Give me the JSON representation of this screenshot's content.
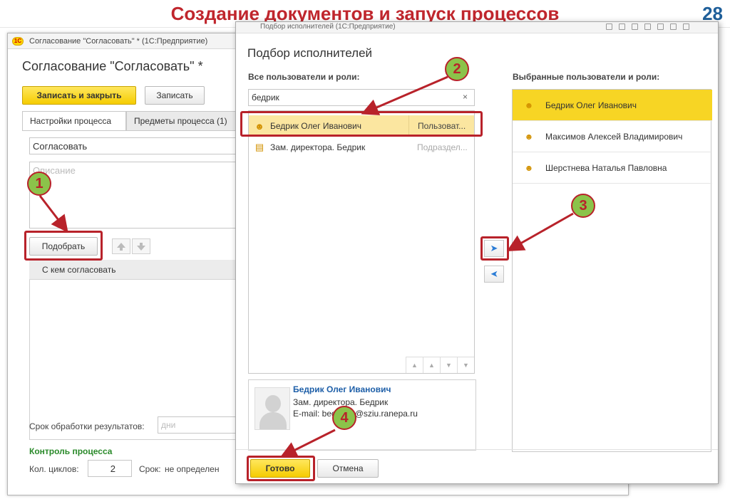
{
  "slide": {
    "title": "Создание документов и запуск процессов",
    "page_number": "28"
  },
  "main_window": {
    "caption": "Согласование \"Согласовать\" * (1С:Предприятие)",
    "logo_text": "1С",
    "form_title": "Согласование \"Согласовать\" *",
    "buttons": {
      "save_close": "Записать и закрыть",
      "save": "Записать",
      "pick": "Подобрать"
    },
    "tabs": [
      {
        "label": "Настройки процесса"
      },
      {
        "label": "Предметы процесса (1)"
      }
    ],
    "name_value": "Согласовать",
    "description_placeholder": "Описание",
    "table_header": "С кем согласовать",
    "deadline_label": "Срок обработки результатов:",
    "deadline_placeholder": "дни",
    "control_section": "Контроль процесса",
    "cycles_label": "Кол. циклов:",
    "cycles_value": "2",
    "term_label": "Срок:",
    "term_value": "не определен"
  },
  "dialog": {
    "caption": "Подбор исполнителей (1С:Предприятие)",
    "title": "Подбор исполнителей",
    "all_label": "Все пользователи и роли:",
    "selected_label": "Выбранные пользователи и роли:",
    "search_value": "бедрик",
    "search_clear": "×",
    "results": [
      {
        "name": "Бедрик Олег Иванович",
        "type": "Пользоват...",
        "icon": "user-icon"
      },
      {
        "name": "Зам. директора. Бедрик",
        "type": "Подраздел...",
        "icon": "folder-icon"
      }
    ],
    "selected": [
      {
        "name": "Бедрик Олег Иванович"
      },
      {
        "name": "Максимов Алексей Владимирович"
      },
      {
        "name": "Шерстнева Наталья Павловна"
      }
    ],
    "card": {
      "name": "Бедрик Олег Иванович",
      "position": "Зам. директора. Бедрик",
      "email": "E-mail: bedrik_o@sziu.ranepa.ru"
    },
    "buttons": {
      "done": "Готово",
      "cancel": "Отмена"
    }
  },
  "markers": [
    "1",
    "2",
    "3",
    "4"
  ],
  "colors": {
    "title_red": "#c0262d",
    "page_num_blue": "#1f5f9a",
    "highlight_yellow": "#f7d524",
    "annotation_red": "#b8222a",
    "marker_green": "#8bc34a"
  }
}
